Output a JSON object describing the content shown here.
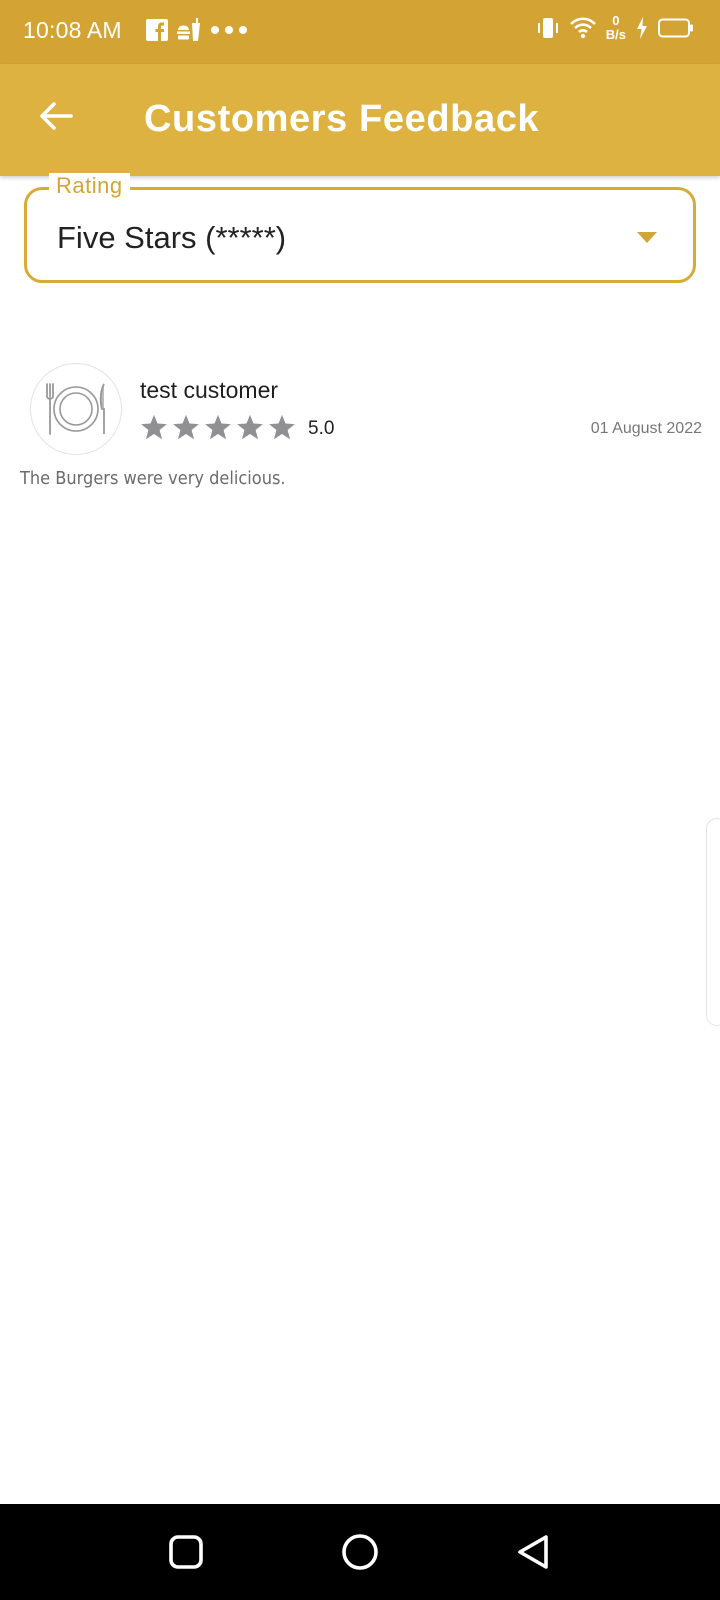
{
  "status_bar": {
    "time": "10:08 AM",
    "net_speed_value": "0",
    "net_speed_unit": "B/s",
    "icons": [
      "facebook-icon",
      "food-icon",
      "more-dots-icon",
      "vibrate-icon",
      "wifi-icon",
      "charging-icon",
      "battery-icon"
    ]
  },
  "app_bar": {
    "title": "Customers Feedback",
    "back_icon": "arrow-left-icon"
  },
  "rating_filter": {
    "label": "Rating",
    "selected": "Five Stars (*****)"
  },
  "reviews": [
    {
      "customer": "test customer",
      "rating_value": 5,
      "rating_label": "5.0",
      "date": "01 August 2022",
      "text": "The Burgers were very delicious."
    }
  ],
  "colors": {
    "status_bar": "#d3a433",
    "app_bar": "#ddb240",
    "accent": "#d7ab35",
    "star": "#8f8f94",
    "nav_bar": "#000000"
  }
}
